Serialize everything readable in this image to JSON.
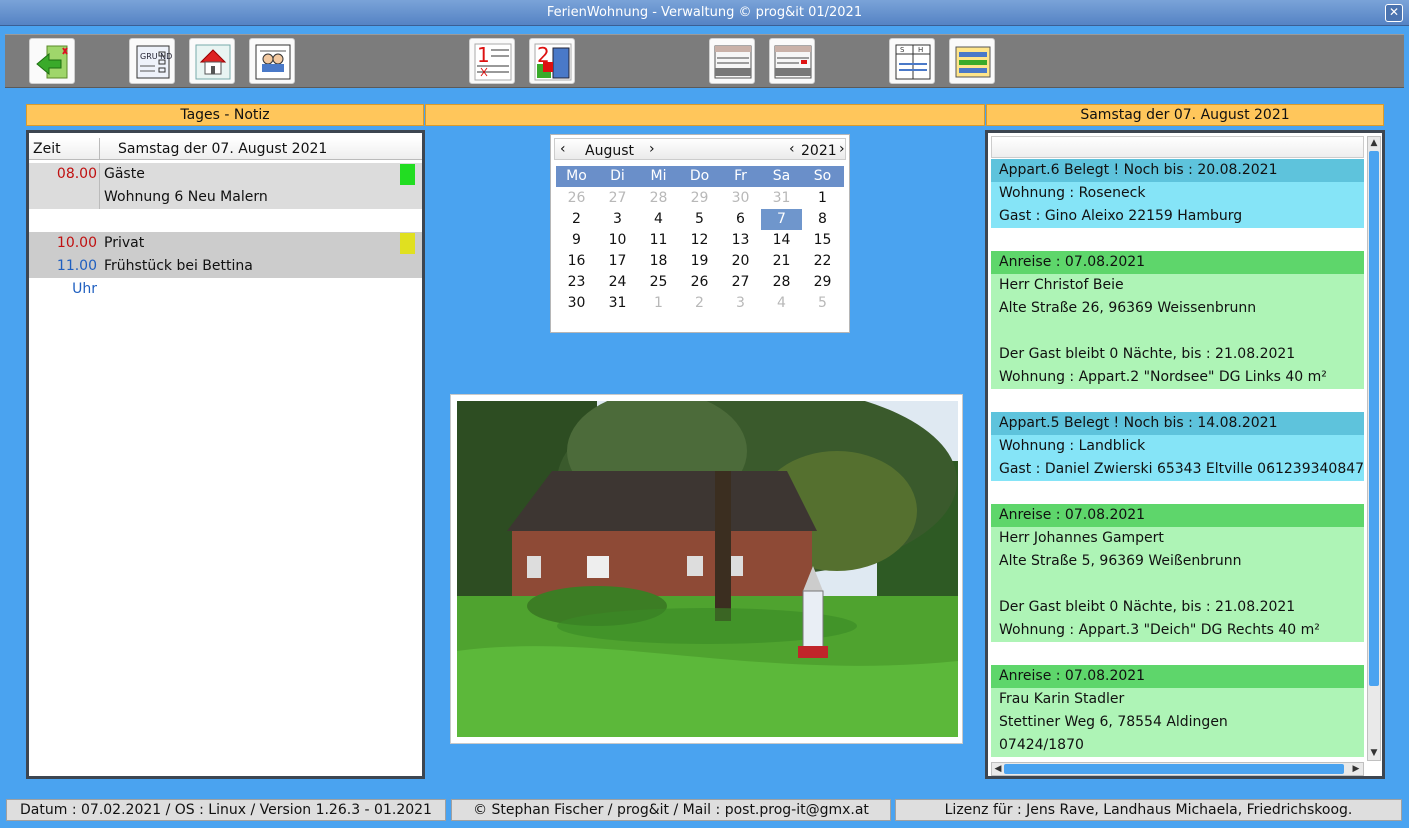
{
  "window": {
    "title": "FerienWohnung - Verwaltung      © prog&it 01/2021",
    "close_label": "✕"
  },
  "toolbar": {
    "buttons": [
      {
        "name": "exit-icon"
      },
      {
        "name": "grund-data-icon",
        "text": "GRU ND"
      },
      {
        "name": "house-icon"
      },
      {
        "name": "guests-icon"
      },
      {
        "name": "plan-1-icon",
        "text": "1"
      },
      {
        "name": "plan-2-icon",
        "text": "2"
      },
      {
        "name": "list-a-icon"
      },
      {
        "name": "list-b-icon"
      },
      {
        "name": "schedule-icon"
      },
      {
        "name": "table-icon"
      }
    ]
  },
  "headers": {
    "left": "Tages - Notiz",
    "middle": "",
    "right": "Samstag der 07. August 2021"
  },
  "notes": {
    "col_time": "Zeit",
    "col_date": "Samstag der 07. August 2021",
    "rows": [
      {
        "time": "08.00 Uhr",
        "text": "Gäste",
        "time_color": "#c01010",
        "flag": "#22dd22",
        "bg": "#dcdcdc"
      },
      {
        "time": "",
        "text": "Wohnung 6   Neu Malern",
        "bg": "#dcdcdc"
      },
      {
        "time": "10.00 Uhr",
        "text": "Privat",
        "time_color": "#c01010",
        "flag": "#e0e020",
        "bg": "#cccccc"
      },
      {
        "time": "11.00 Uhr",
        "text": "Frühstück bei Bettina",
        "time_color": "#1f5fc0",
        "bg": "#cccccc"
      }
    ]
  },
  "calendar": {
    "prev_month": "‹",
    "next_month": "›",
    "month": "August",
    "prev_year": "‹",
    "year": "2021",
    "next_year": "›",
    "weekdays": [
      "Mo",
      "Di",
      "Mi",
      "Do",
      "Fr",
      "Sa",
      "So"
    ],
    "weeks": [
      [
        "26",
        "27",
        "28",
        "29",
        "30",
        "31",
        "1"
      ],
      [
        "2",
        "3",
        "4",
        "5",
        "6",
        "7",
        "8"
      ],
      [
        "9",
        "10",
        "11",
        "12",
        "13",
        "14",
        "15"
      ],
      [
        "16",
        "17",
        "18",
        "19",
        "20",
        "21",
        "22"
      ],
      [
        "23",
        "24",
        "25",
        "26",
        "27",
        "28",
        "29"
      ],
      [
        "30",
        "31",
        "1",
        "2",
        "3",
        "4",
        "5"
      ]
    ],
    "selected_day": "7"
  },
  "bookings": [
    {
      "style": "cyan-h",
      "text": "Appart.6  Belegt !                 Noch bis : 20.08.2021"
    },
    {
      "style": "cyan",
      "text": "Wohnung : Roseneck"
    },
    {
      "style": "cyan",
      "text": "Gast :  Gino  Aleixo  22159  Hamburg"
    },
    {
      "style": "",
      "text": ""
    },
    {
      "style": "green-h",
      "text": "Anreise  : 07.08.2021"
    },
    {
      "style": "green",
      "text": "Herr  Christof  Beie"
    },
    {
      "style": "green",
      "text": "Alte Straße 26,  96369  Weissenbrunn"
    },
    {
      "style": "green",
      "text": ""
    },
    {
      "style": "green",
      "text": "Der Gast bleibt 0  Nächte, bis :  21.08.2021"
    },
    {
      "style": "green",
      "text": "Wohnung : Appart.2  \"Nordsee\"  DG Links 40 m²"
    },
    {
      "style": "",
      "text": ""
    },
    {
      "style": "cyan-h",
      "text": "Appart.5  Belegt !                 Noch bis : 14.08.2021"
    },
    {
      "style": "cyan",
      "text": "Wohnung : Landblick"
    },
    {
      "style": "cyan",
      "text": "Gast :  Daniel  Zwierski  65343  Eltville  061239340847"
    },
    {
      "style": "",
      "text": ""
    },
    {
      "style": "green-h",
      "text": "Anreise  : 07.08.2021"
    },
    {
      "style": "green",
      "text": "Herr  Johannes  Gampert"
    },
    {
      "style": "green",
      "text": "Alte Straße 5,  96369  Weißenbrunn"
    },
    {
      "style": "green",
      "text": ""
    },
    {
      "style": "green",
      "text": "Der Gast bleibt 0  Nächte, bis :  21.08.2021"
    },
    {
      "style": "green",
      "text": "Wohnung : Appart.3  \"Deich\"   DG Rechts 40 m²"
    },
    {
      "style": "",
      "text": ""
    },
    {
      "style": "green-h",
      "text": "Anreise  : 07.08.2021"
    },
    {
      "style": "green",
      "text": "Frau  Karin  Stadler"
    },
    {
      "style": "green",
      "text": "Stettiner Weg 6,  78554  Aldingen"
    },
    {
      "style": "green",
      "text": "07424/1870"
    }
  ],
  "status": {
    "left": "Datum : 07.02.2021 / OS : Linux  /  Version 1.26.3 - 01.2021",
    "middle": "© Stephan Fischer / prog&it  /  Mail : post.prog-it@gmx.at",
    "right": "Lizenz für  : Jens Rave, Landhaus Michaela, Friedrichskoog."
  }
}
